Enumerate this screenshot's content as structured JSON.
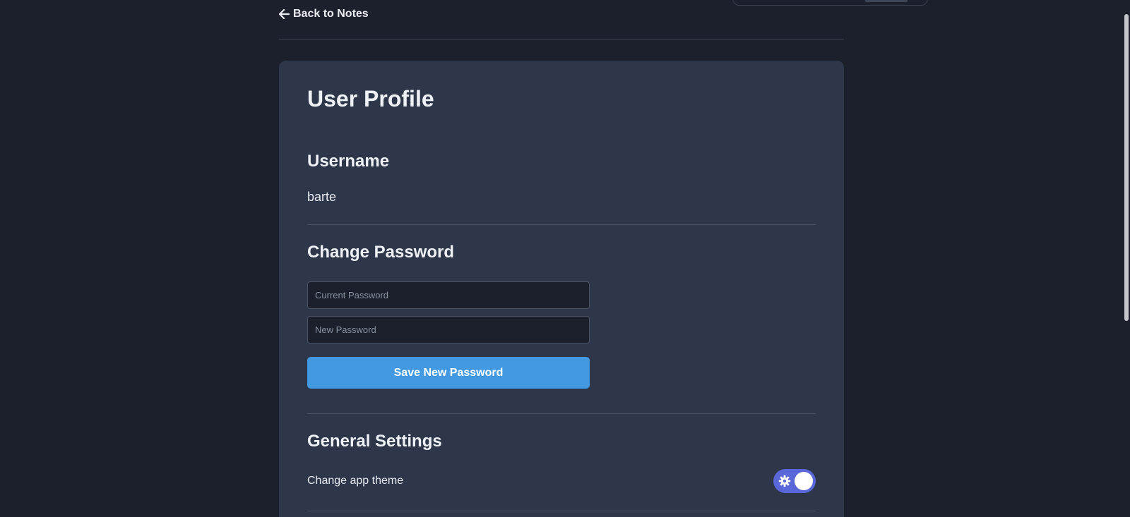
{
  "nav": {
    "back_label": "Back to Notes"
  },
  "profile": {
    "title": "User Profile",
    "username_heading": "Username",
    "username_value": "barte"
  },
  "password": {
    "heading": "Change Password",
    "current_placeholder": "Current Password",
    "new_placeholder": "New Password",
    "save_label": "Save New Password"
  },
  "settings": {
    "heading": "General Settings",
    "theme_label": "Change app theme",
    "theme_toggle_on": true
  },
  "icons": {
    "back": "arrow-left-icon",
    "toggle": "gear-icon"
  },
  "colors": {
    "background": "#1b202c",
    "card": "#2e3749",
    "accent": "#4299e1",
    "toggle": "#5a67d8"
  }
}
